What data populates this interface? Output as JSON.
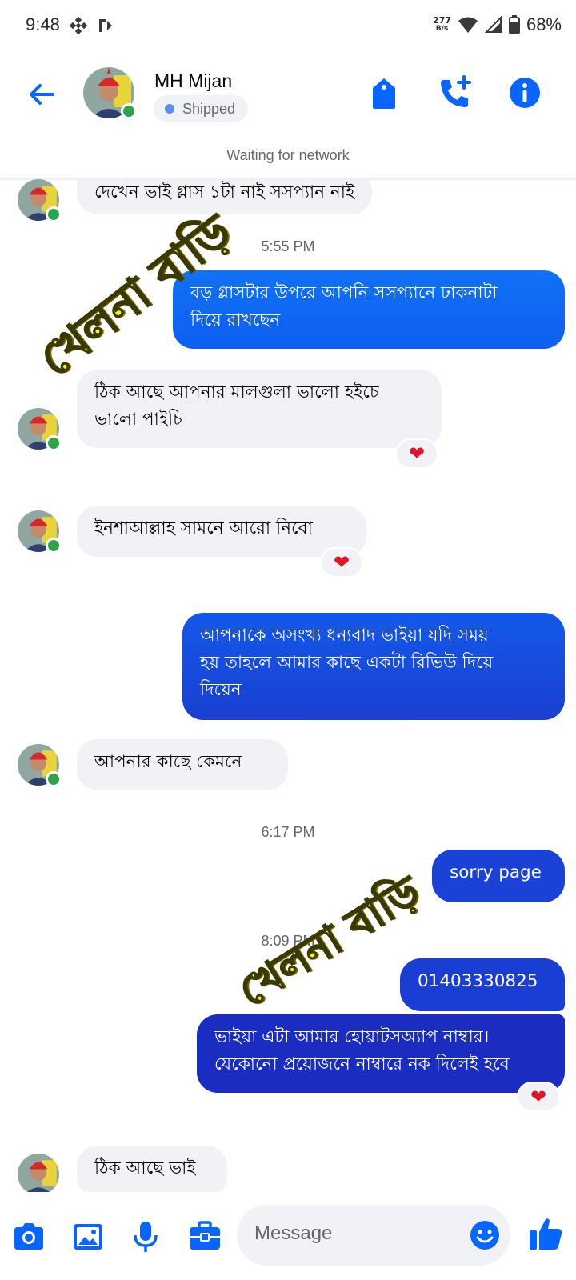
{
  "status_bar": {
    "time": "9:48",
    "network_speed_top": "277",
    "network_speed_bottom": "B/s",
    "battery": "68%"
  },
  "header": {
    "contact_name": "MH Mijan",
    "label_badge": "Shipped",
    "network_status": "Waiting for network",
    "icons": [
      "back-arrow-icon",
      "tag-icon",
      "add-call-icon",
      "info-icon"
    ]
  },
  "messages": [
    {
      "dir": "in",
      "text": "দেখেন ভাই গ্লাস ১টা নাই সসপ্যান নাই"
    },
    {
      "type": "time",
      "text": "5:55 PM"
    },
    {
      "dir": "out",
      "text": "বড় গ্লাসটার উপরে আপনি সসপ্যানে ঢাকনাটা\nদিয়ে রাখছেন"
    },
    {
      "dir": "in",
      "text": "ঠিক আছে আপনার মালগুলা ভালো হইচে\nভালো পাইচি",
      "reaction": "❤"
    },
    {
      "dir": "in",
      "text": "ইনশাআল্লাহ সামনে আরো নিবো",
      "reaction": "❤"
    },
    {
      "dir": "out",
      "text": "আপনাকে অসংখ্য ধন্যবাদ ভাইয়া যদি সময়\nহয় তাহলে আমার কাছে একটা রিভিউ  দিয়ে\nদিয়েন"
    },
    {
      "dir": "in",
      "text": "আপনার কাছে কেমনে"
    },
    {
      "type": "time",
      "text": "6:17 PM"
    },
    {
      "dir": "out",
      "text": "sorry page"
    },
    {
      "type": "time",
      "text": "8:09 PM"
    },
    {
      "dir": "out",
      "text": "01403330825"
    },
    {
      "dir": "out",
      "text": "ভাইয়া এটা আমার হোয়াটসঅ্যাপ নাম্বার।\nযেকোনো প্রয়োজনে নাম্বারে নক দিলেই হবে",
      "reaction": "❤"
    },
    {
      "dir": "in",
      "text": "ঠিক আছে ভাই"
    }
  ],
  "watermark": {
    "text": "খেলনা বাড়ি"
  },
  "composer": {
    "placeholder": "Message",
    "icons": [
      "camera-icon",
      "gallery-icon",
      "microphone-icon",
      "toolbox-icon",
      "emoji-icon",
      "thumbs-up-icon"
    ]
  },
  "colors": {
    "accent": "#0866ff",
    "incoming_bubble": "#f0f2f5",
    "online": "#31a24c",
    "outgoing_gradient_top": "#1271f5",
    "outgoing_gradient_bottom": "#1a2dc0",
    "watermark": "#f7f21a"
  }
}
